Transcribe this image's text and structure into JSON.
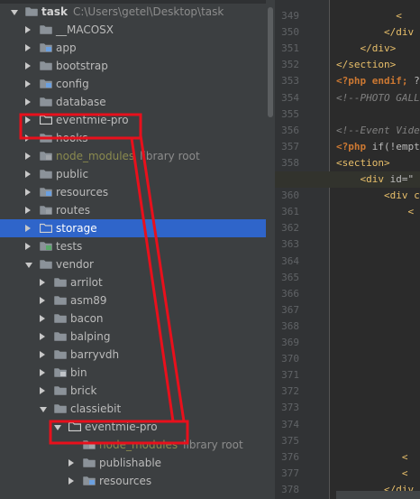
{
  "project_tree": {
    "root": {
      "name": "task",
      "path": "C:\\Users\\getel\\Desktop\\task"
    },
    "items": [
      {
        "label": "__MACOSX",
        "depth": 1,
        "state": "collapsed",
        "icon": "folder-icon"
      },
      {
        "label": "app",
        "depth": 1,
        "state": "collapsed",
        "icon": "source-folder-icon"
      },
      {
        "label": "bootstrap",
        "depth": 1,
        "state": "collapsed",
        "icon": "folder-icon"
      },
      {
        "label": "config",
        "depth": 1,
        "state": "collapsed",
        "icon": "config-folder-icon"
      },
      {
        "label": "database",
        "depth": 1,
        "state": "collapsed",
        "icon": "folder-icon"
      },
      {
        "label": "eventmie-pro",
        "depth": 1,
        "state": "collapsed",
        "icon": "folder-outline-icon"
      },
      {
        "label": "hooks",
        "depth": 1,
        "state": "collapsed",
        "icon": "folder-icon"
      },
      {
        "label": "node_modules",
        "suffix": "library root",
        "depth": 1,
        "state": "collapsed",
        "icon": "library-folder-icon",
        "excluded": true
      },
      {
        "label": "public",
        "depth": 1,
        "state": "collapsed",
        "icon": "folder-icon"
      },
      {
        "label": "resources",
        "depth": 1,
        "state": "collapsed",
        "icon": "resources-folder-icon"
      },
      {
        "label": "routes",
        "depth": 1,
        "state": "collapsed",
        "icon": "routes-folder-icon"
      },
      {
        "label": "storage",
        "depth": 1,
        "state": "collapsed",
        "icon": "folder-outline-icon",
        "selected": true
      },
      {
        "label": "tests",
        "depth": 1,
        "state": "collapsed",
        "icon": "test-folder-icon"
      },
      {
        "label": "vendor",
        "depth": 1,
        "state": "expanded",
        "icon": "folder-icon"
      },
      {
        "label": "arrilot",
        "depth": 2,
        "state": "collapsed",
        "icon": "folder-icon"
      },
      {
        "label": "asm89",
        "depth": 2,
        "state": "collapsed",
        "icon": "folder-icon"
      },
      {
        "label": "bacon",
        "depth": 2,
        "state": "collapsed",
        "icon": "folder-icon"
      },
      {
        "label": "balping",
        "depth": 2,
        "state": "collapsed",
        "icon": "folder-icon"
      },
      {
        "label": "barryvdh",
        "depth": 2,
        "state": "collapsed",
        "icon": "folder-icon"
      },
      {
        "label": "bin",
        "depth": 2,
        "state": "collapsed",
        "icon": "bin-folder-icon"
      },
      {
        "label": "brick",
        "depth": 2,
        "state": "collapsed",
        "icon": "folder-icon"
      },
      {
        "label": "classiebit",
        "depth": 2,
        "state": "expanded",
        "icon": "folder-icon"
      },
      {
        "label": "eventmie-pro",
        "depth": 3,
        "state": "expanded",
        "icon": "folder-outline-icon"
      },
      {
        "label": "node_modules",
        "suffix": "library root",
        "depth": 4,
        "state": "none",
        "icon": "library-folder-icon",
        "excluded": true
      },
      {
        "label": "publishable",
        "depth": 4,
        "state": "collapsed",
        "icon": "folder-icon"
      },
      {
        "label": "resources",
        "depth": 4,
        "state": "collapsed",
        "icon": "resources-folder-icon"
      }
    ]
  },
  "editor": {
    "current_line": 359,
    "lines": [
      {
        "n": 349,
        "parts": [
          {
            "t": "          <",
            "c": "tag"
          }
        ]
      },
      {
        "n": 350,
        "parts": [
          {
            "t": "        </div",
            "c": "tag"
          }
        ]
      },
      {
        "n": 351,
        "parts": [
          {
            "t": "    </div>",
            "c": "tag"
          }
        ]
      },
      {
        "n": 352,
        "parts": [
          {
            "t": "</section>",
            "c": "tag"
          }
        ]
      },
      {
        "n": 353,
        "parts": [
          {
            "t": "<?php ",
            "c": "kw"
          },
          {
            "t": "endif;",
            "c": "kw"
          },
          {
            "t": " ?",
            "c": "attr"
          }
        ]
      },
      {
        "n": 354,
        "parts": [
          {
            "t": "<!--PHOTO GALL",
            "c": "cm"
          }
        ]
      },
      {
        "n": 355,
        "parts": []
      },
      {
        "n": 356,
        "parts": [
          {
            "t": "<!--Event Vide",
            "c": "cm"
          }
        ]
      },
      {
        "n": 357,
        "parts": [
          {
            "t": "<?php ",
            "c": "kw"
          },
          {
            "t": "if(!empt",
            "c": "attr"
          }
        ]
      },
      {
        "n": 358,
        "parts": [
          {
            "t": "<section>",
            "c": "tag"
          }
        ]
      },
      {
        "n": 359,
        "parts": [
          {
            "t": "    <div ",
            "c": "tag"
          },
          {
            "t": "id=\"",
            "c": "attr"
          }
        ]
      },
      {
        "n": 360,
        "parts": [
          {
            "t": "        <div c",
            "c": "tag"
          }
        ]
      },
      {
        "n": 361,
        "parts": [
          {
            "t": "            <",
            "c": "tag"
          }
        ]
      },
      {
        "n": 362,
        "parts": []
      },
      {
        "n": 363,
        "parts": []
      },
      {
        "n": 364,
        "parts": []
      },
      {
        "n": 365,
        "parts": []
      },
      {
        "n": 366,
        "parts": []
      },
      {
        "n": 367,
        "parts": []
      },
      {
        "n": 368,
        "parts": []
      },
      {
        "n": 369,
        "parts": []
      },
      {
        "n": 370,
        "parts": []
      },
      {
        "n": 371,
        "parts": []
      },
      {
        "n": 372,
        "parts": []
      },
      {
        "n": 373,
        "parts": []
      },
      {
        "n": 374,
        "parts": []
      },
      {
        "n": 375,
        "parts": []
      },
      {
        "n": 376,
        "parts": [
          {
            "t": "           <",
            "c": "tag"
          }
        ]
      },
      {
        "n": 377,
        "parts": [
          {
            "t": "           <",
            "c": "tag"
          }
        ]
      },
      {
        "n": 378,
        "parts": [
          {
            "t": "        </div",
            "c": "tag"
          }
        ]
      }
    ]
  },
  "annotation_color": "#e8101c",
  "colors": {
    "folder": "#8b9299",
    "selection": "#2f65ca",
    "excluded_text": "#8a8a4e"
  }
}
